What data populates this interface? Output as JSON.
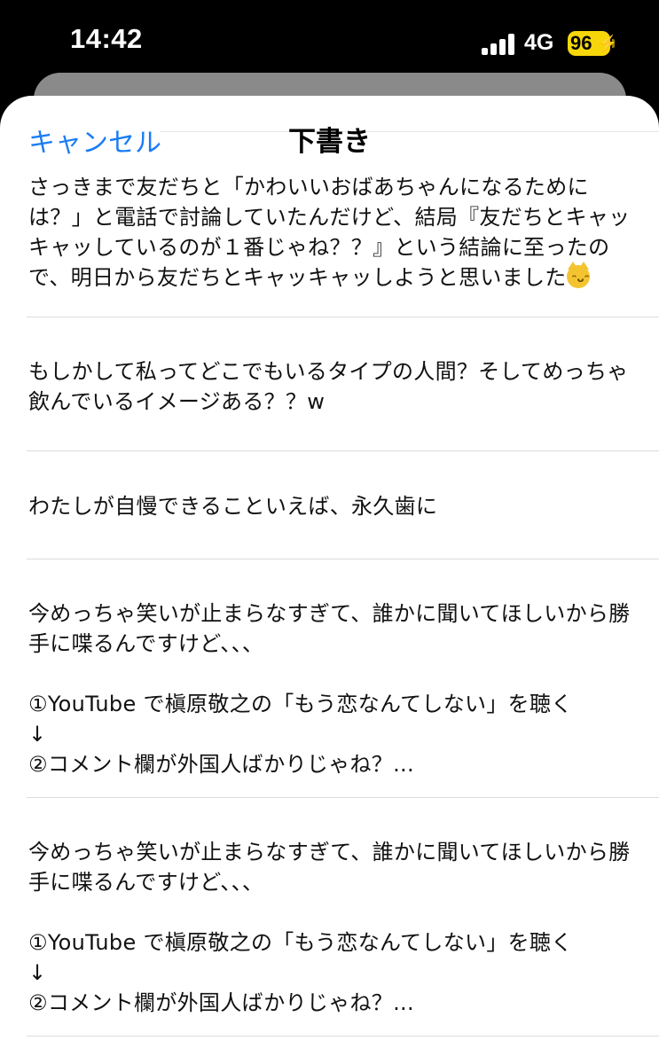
{
  "status_bar": {
    "time": "14:42",
    "network": "4G",
    "battery": "96"
  },
  "nav": {
    "cancel_label": "キャンセル",
    "title": "下書き"
  },
  "drafts": [
    {
      "text": "さっきまで友だちと「かわいいおばあちゃんになるためには？」と電話で討論していたんだけど、結局『友だちとキャッキャッしているのが１番じゃね？？』という結論に至ったので、明日から友だちとキャッキャッしようと思いました",
      "emoji": "grinning-cat"
    },
    {
      "text": "もしかして私ってどこでもいるタイプの人間？そしてめっちゃ飲んでいるイメージある？？w"
    },
    {
      "text": "わたしが自慢できることいえば、永久歯に"
    },
    {
      "text": "今めっちゃ笑いが止まらなすぎて、誰かに聞いてほしいから勝手に喋るんですけど、、、\n\n①YouTube で槇原敬之の「もう恋なんてしない」を聴く\n↓\n②コメント欄が外国人ばかりじゃね？..."
    },
    {
      "text": "今めっちゃ笑いが止まらなすぎて、誰かに聞いてほしいから勝手に喋るんですけど、、、\n\n①YouTube で槇原敬之の「もう恋なんてしない」を聴く\n↓\n②コメント欄が外国人ばかりじゃね？..."
    }
  ],
  "colors": {
    "accent": "#1a7cf4",
    "battery": "#f6d60a"
  }
}
